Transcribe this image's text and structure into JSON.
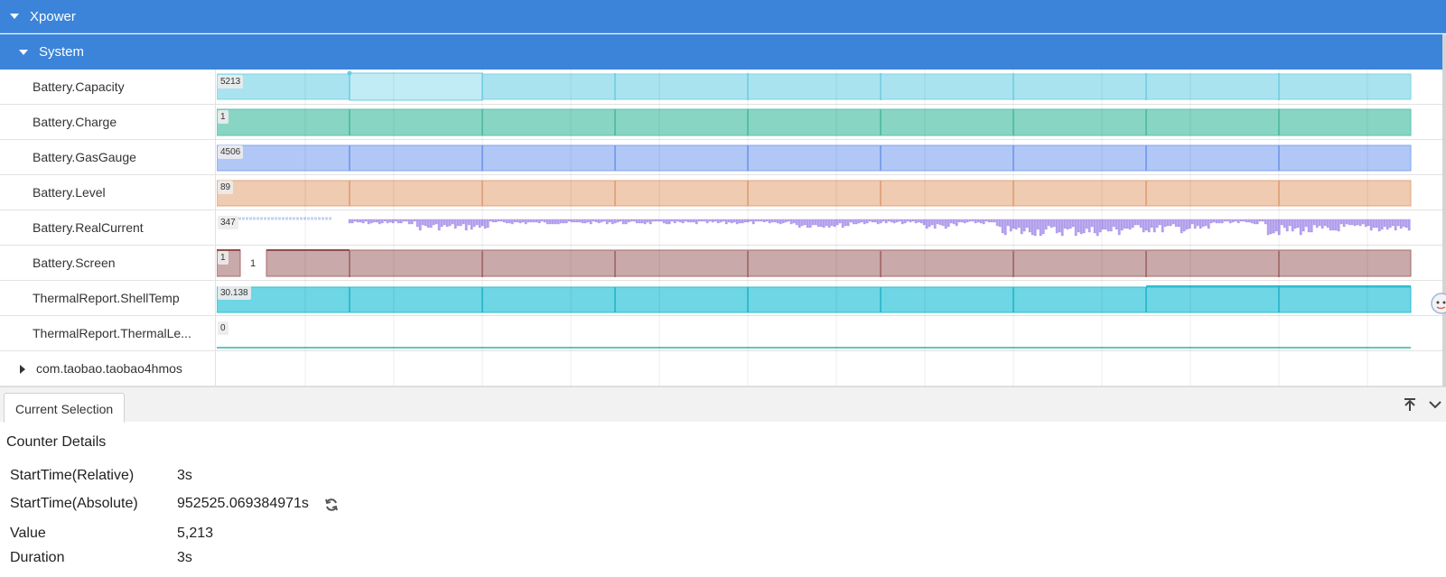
{
  "groups": {
    "xpower": "Xpower",
    "system": "System",
    "package": "com.taobao.taobao4hmos"
  },
  "colors": {
    "header_bg": "#3b84d9",
    "capacity": "#9fe0ee",
    "charge": "#7fd1c0",
    "gasgauge": "#a9c4f6",
    "level": "#f0c6a8",
    "realcurrent": "#b7a3ef",
    "screen": "#c7a3a3",
    "shelltemp": "#63d3e2",
    "thermallevel": "#5fc9bb"
  },
  "tracks": [
    {
      "key": "capacity",
      "label": "Battery.Capacity",
      "value": "5213"
    },
    {
      "key": "charge",
      "label": "Battery.Charge",
      "value": "1"
    },
    {
      "key": "gasgauge",
      "label": "Battery.GasGauge",
      "value": "4506"
    },
    {
      "key": "level",
      "label": "Battery.Level",
      "value": "89"
    },
    {
      "key": "realcurrent",
      "label": "Battery.RealCurrent",
      "value": "347"
    },
    {
      "key": "screen",
      "label": "Battery.Screen",
      "value": "1",
      "extra_value": "1"
    },
    {
      "key": "shelltemp",
      "label": "ThermalReport.ShellTemp",
      "value": "30.138"
    },
    {
      "key": "thermallevel",
      "label": "ThermalReport.ThermalLe...",
      "value": "0"
    }
  ],
  "panel": {
    "tab": "Current Selection",
    "title": "Counter Details",
    "rows": [
      {
        "key": "StartTime(Relative)",
        "value": "3s"
      },
      {
        "key": "StartTime(Absolute)",
        "value": "952525.069384971s"
      },
      {
        "key": "Value",
        "value": "5,213"
      },
      {
        "key": "Duration",
        "value": "3s"
      }
    ]
  },
  "icons": {
    "expand": "caret-down-icon",
    "collapsed": "caret-right-icon",
    "refresh": "refresh-icon",
    "pin": "pin-to-top-icon",
    "collapse": "chevron-down-icon"
  }
}
